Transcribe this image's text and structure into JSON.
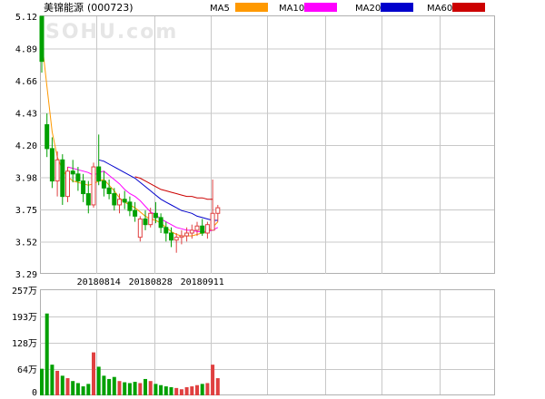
{
  "header": {
    "stock_name": "美锦能源",
    "stock_code": "(000723)",
    "watermark": "SOHU.com"
  },
  "legend": [
    {
      "name": "MA5",
      "color": "#ff9900"
    },
    {
      "name": "MA10",
      "color": "#ff00ff"
    },
    {
      "name": "MA20",
      "color": "#0000cc"
    },
    {
      "name": "MA60",
      "color": "#cc0000"
    }
  ],
  "colors": {
    "up": "#e04040",
    "down": "#00a000",
    "grid": "#c8c8c8"
  },
  "chart_data": [
    {
      "type": "candlestick",
      "title": "",
      "y_ticks": [
        "5.12",
        "4.89",
        "4.66",
        "4.43",
        "4.20",
        "3.98",
        "3.75",
        "3.52",
        "3.29"
      ],
      "ylim": [
        3.29,
        5.12
      ],
      "x_ticks": [
        {
          "index": 11,
          "label": "20180814"
        },
        {
          "index": 21,
          "label": "20180828"
        },
        {
          "index": 31,
          "label": "20180911"
        }
      ],
      "ohlc": [
        [
          5.12,
          5.12,
          4.72,
          4.8
        ],
        [
          4.35,
          4.43,
          4.12,
          4.18
        ],
        [
          4.18,
          4.26,
          3.9,
          3.95
        ],
        [
          3.95,
          4.16,
          3.84,
          4.1
        ],
        [
          4.1,
          4.14,
          3.78,
          3.84
        ],
        [
          3.84,
          4.05,
          3.8,
          4.02
        ],
        [
          4.02,
          4.1,
          3.94,
          4.0
        ],
        [
          4.0,
          4.05,
          3.88,
          3.95
        ],
        [
          3.95,
          4.0,
          3.8,
          3.86
        ],
        [
          3.86,
          3.95,
          3.72,
          3.78
        ],
        [
          3.78,
          4.08,
          3.76,
          4.05
        ],
        [
          4.05,
          4.28,
          3.92,
          3.95
        ],
        [
          3.95,
          4.02,
          3.84,
          3.9
        ],
        [
          3.9,
          3.96,
          3.82,
          3.86
        ],
        [
          3.86,
          3.9,
          3.74,
          3.78
        ],
        [
          3.78,
          3.86,
          3.72,
          3.82
        ],
        [
          3.82,
          3.88,
          3.75,
          3.8
        ],
        [
          3.8,
          3.84,
          3.7,
          3.74
        ],
        [
          3.74,
          3.8,
          3.66,
          3.7
        ],
        [
          3.55,
          3.7,
          3.52,
          3.68
        ],
        [
          3.68,
          3.74,
          3.6,
          3.64
        ],
        [
          3.64,
          3.76,
          3.62,
          3.72
        ],
        [
          3.72,
          3.8,
          3.65,
          3.69
        ],
        [
          3.69,
          3.72,
          3.58,
          3.62
        ],
        [
          3.62,
          3.66,
          3.52,
          3.58
        ],
        [
          3.58,
          3.62,
          3.48,
          3.53
        ],
        [
          3.53,
          3.58,
          3.44,
          3.55
        ],
        [
          3.55,
          3.6,
          3.5,
          3.56
        ],
        [
          3.56,
          3.62,
          3.52,
          3.58
        ],
        [
          3.58,
          3.64,
          3.54,
          3.6
        ],
        [
          3.6,
          3.66,
          3.56,
          3.63
        ],
        [
          3.63,
          3.68,
          3.56,
          3.58
        ],
        [
          3.58,
          3.66,
          3.54,
          3.64
        ],
        [
          3.6,
          3.96,
          3.6,
          3.72
        ],
        [
          3.72,
          3.78,
          3.66,
          3.76
        ]
      ],
      "ma5": [
        4.95,
        4.62,
        4.3,
        4.12,
        4.03,
        3.98,
        3.95,
        3.94,
        3.93,
        3.92,
        3.93,
        3.95,
        3.96,
        3.92,
        3.88,
        3.83,
        3.8,
        3.78,
        3.76,
        3.73,
        3.7,
        3.68,
        3.67,
        3.65,
        3.62,
        3.59,
        3.57,
        3.56,
        3.56,
        3.56,
        3.57,
        3.58,
        3.59,
        3.62,
        3.66
      ],
      "ma10": [
        null,
        null,
        null,
        null,
        null,
        4.05,
        4.04,
        4.03,
        4.02,
        4.01,
        3.99,
        4.01,
        4.02,
        3.99,
        3.96,
        3.93,
        3.89,
        3.86,
        3.84,
        3.81,
        3.77,
        3.73,
        3.71,
        3.68,
        3.66,
        3.64,
        3.62,
        3.61,
        3.6,
        3.6,
        3.59,
        3.59,
        3.59,
        3.6,
        3.62
      ],
      "ma20": [
        null,
        null,
        null,
        null,
        null,
        null,
        null,
        null,
        null,
        null,
        null,
        4.1,
        4.09,
        4.07,
        4.05,
        4.03,
        4.01,
        3.99,
        3.97,
        3.94,
        3.91,
        3.88,
        3.85,
        3.82,
        3.8,
        3.78,
        3.76,
        3.74,
        3.73,
        3.72,
        3.7,
        3.69,
        3.68,
        3.67,
        3.67
      ],
      "ma60": [
        null,
        null,
        null,
        null,
        null,
        null,
        null,
        null,
        null,
        null,
        null,
        null,
        null,
        null,
        null,
        null,
        null,
        null,
        3.98,
        3.97,
        3.95,
        3.93,
        3.91,
        3.89,
        3.88,
        3.87,
        3.86,
        3.85,
        3.84,
        3.84,
        3.83,
        3.83,
        3.82,
        3.82,
        null
      ]
    },
    {
      "type": "bar",
      "title": "",
      "y_ticks": [
        "257万",
        "193万",
        "128万",
        "64万",
        "0"
      ],
      "ylim": [
        0,
        257
      ],
      "unit": "万",
      "volume": [
        65,
        200,
        75,
        60,
        48,
        42,
        35,
        30,
        22,
        28,
        105,
        70,
        48,
        40,
        45,
        35,
        32,
        30,
        33,
        30,
        40,
        35,
        28,
        25,
        22,
        20,
        18,
        15,
        20,
        22,
        25,
        28,
        30,
        75,
        42
      ]
    }
  ]
}
